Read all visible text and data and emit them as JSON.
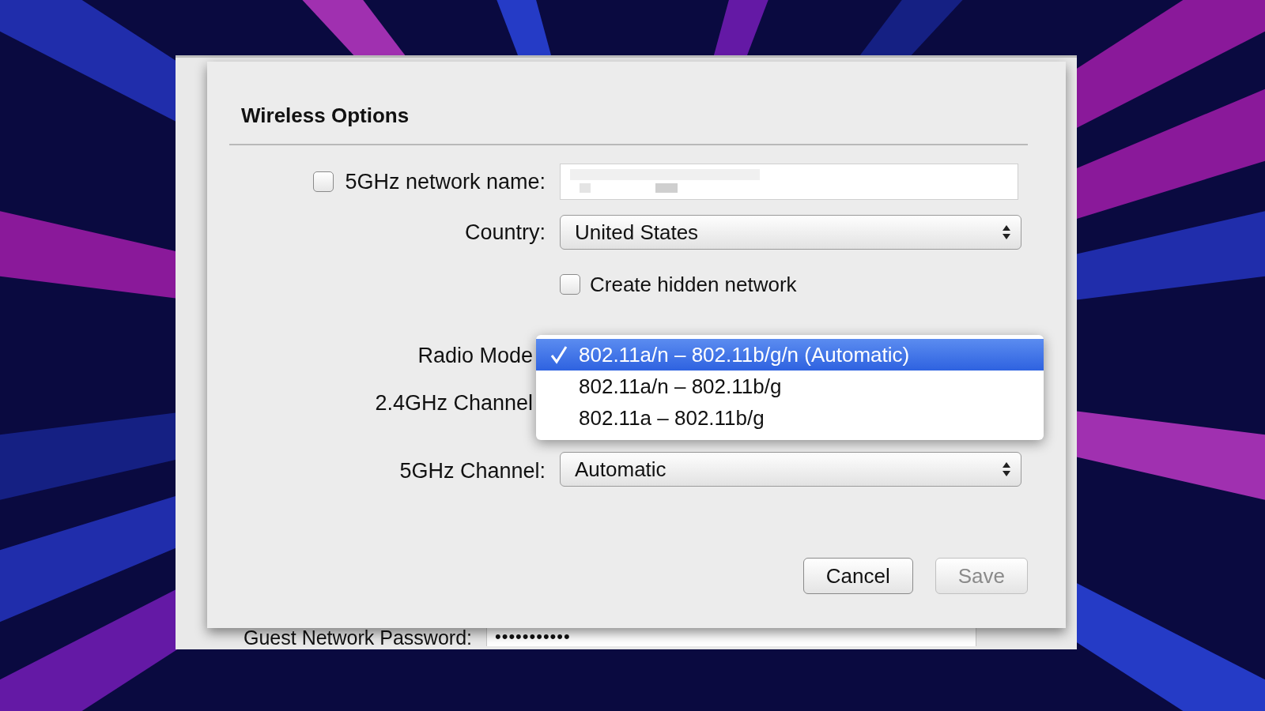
{
  "sheet": {
    "title": "Wireless Options",
    "rows": [
      {
        "kind": "text",
        "label": "5GHz network name:",
        "checked": false
      },
      {
        "kind": "popup",
        "label": "Country:",
        "value": "United States"
      },
      {
        "kind": "checkbox",
        "label": "Create hidden network",
        "checked": false
      },
      {
        "kind": "menu",
        "label": "Radio Mode"
      },
      {
        "kind": "covered",
        "label": "2.4GHz Channel"
      },
      {
        "kind": "popup",
        "label": "5GHz Channel:",
        "value": "Automatic"
      }
    ],
    "menu": {
      "items": [
        {
          "label": "802.11a/n – 802.11b/g/n (Automatic)",
          "selected": true
        },
        {
          "label": "802.11a/n – 802.11b/g",
          "selected": false
        },
        {
          "label": "802.11a – 802.11b/g",
          "selected": false
        }
      ]
    },
    "buttons": [
      {
        "label": "Cancel",
        "disabled": false
      },
      {
        "label": "Save",
        "disabled": true
      }
    ]
  },
  "background_window": {
    "password_label": "Guest Network Password:",
    "password_value": "•••••••••••"
  }
}
